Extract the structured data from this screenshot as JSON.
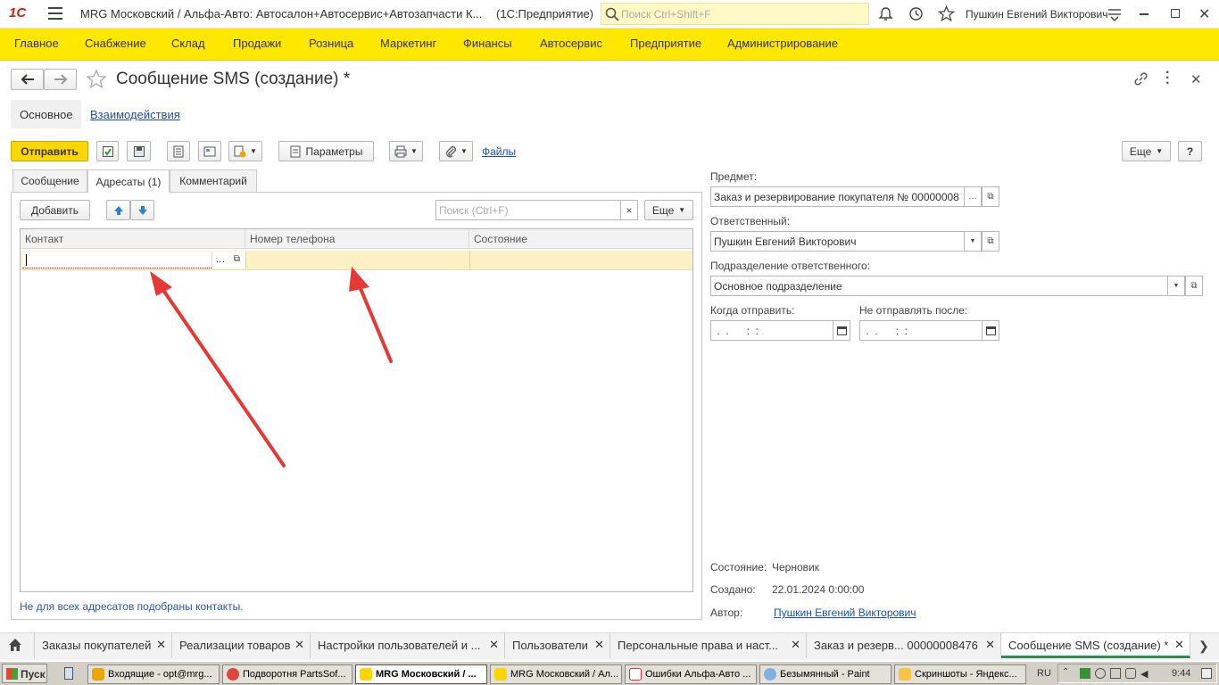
{
  "app": {
    "logo": "1С",
    "title": "MRG Московский / Альфа-Авто: Автосалон+Автосервис+Автозапчасти К...",
    "platform": "(1С:Предприятие)",
    "search_placeholder": "Поиск Ctrl+Shift+F",
    "user": "Пушкин Евгений Викторович"
  },
  "menu": [
    "Главное",
    "Снабжение",
    "Склад",
    "Продажи",
    "Розница",
    "Маркетинг",
    "Финансы",
    "Автосервис",
    "Предприятие",
    "Администрирование"
  ],
  "form": {
    "title": "Сообщение SMS (создание) *",
    "sections": {
      "main": "Основное",
      "interactions": "Взаимодействия"
    },
    "toolbar": {
      "send": "Отправить",
      "params": "Параметры",
      "files": "Файлы",
      "more": "Еще",
      "help": "?"
    },
    "tabs": {
      "message": "Сообщение",
      "recipients": "Адресаты (1)",
      "comment": "Комментарий"
    },
    "grid_toolbar": {
      "add": "Добавить",
      "search_placeholder": "Поиск (Ctrl+F)",
      "more": "Еще"
    },
    "columns": {
      "contact": "Контакт",
      "phone": "Номер телефона",
      "status": "Состояние"
    },
    "row": {
      "contact": "",
      "phone": "",
      "status": ""
    },
    "warning": "Не для всех адресатов подобраны контакты."
  },
  "side": {
    "subject_label": "Предмет:",
    "subject_value": "Заказ и резервирование покупателя № 00000008",
    "responsible_label": "Ответственный:",
    "responsible_value": "Пушкин Евгений Викторович",
    "dept_label": "Подразделение ответственного:",
    "dept_value": "Основное подразделение",
    "send_when_label": "Когда отправить:",
    "send_when_value": " .  .      :  :",
    "not_after_label": "Не отправлять после:",
    "not_after_value": " .  .      :  :",
    "state_label": "Состояние:",
    "state_value": "Черновик",
    "created_label": "Создано:",
    "created_value": "22.01.2024 0:00:00",
    "author_label": "Автор:",
    "author_value": "Пушкин Евгений Викторович"
  },
  "window_tabs": [
    "Заказы покупателей",
    "Реализации товаров",
    "Настройки пользователей и ...",
    "Пользователи",
    "Персональные права и наст...",
    "Заказ и резерв... 00000008476",
    "Сообщение SMS (создание) *"
  ],
  "taskbar": {
    "start": "Пуск",
    "items": [
      "Входящие - opt@mrg...",
      "Подворотня PartsSof...",
      "MRG Московский / ...",
      "MRG Московский / Ал...",
      "Ошибки Альфа-Авто ...",
      "Безымянный - Paint",
      "Скриншоты - Яндекс..."
    ],
    "lang": "RU",
    "time": "9:44"
  },
  "colors": {
    "accent": "#ffe800",
    "arrow": "#e53935",
    "link": "#1b4fb5"
  }
}
